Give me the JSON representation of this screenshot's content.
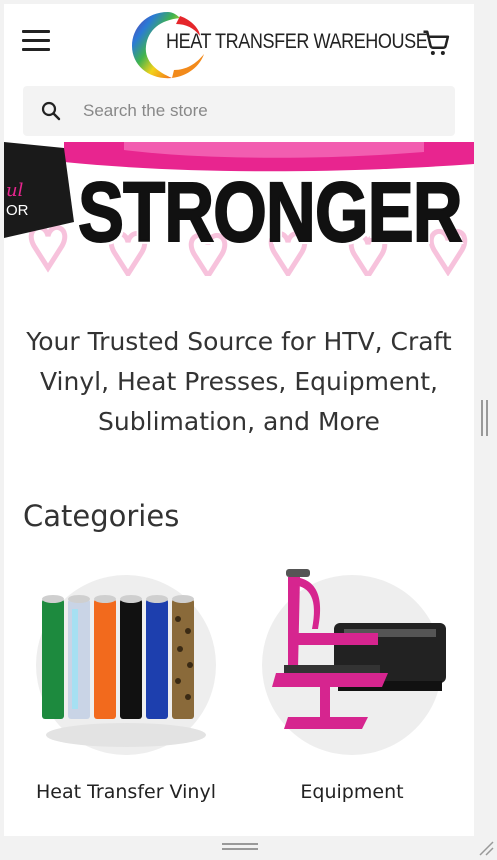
{
  "header": {
    "menu_icon": "hamburger-menu-icon",
    "logo_text": "HEAT TRANSFER WAREHOUSE",
    "cart_icon": "shopping-cart-icon"
  },
  "search": {
    "placeholder": "Search the store",
    "icon": "search-icon"
  },
  "banner": {
    "headline": "STRONGER",
    "side_text_1": "ul",
    "side_text_2": "OR",
    "accent_color": "#e8258f"
  },
  "tagline": "Your Trusted Source for HTV, Craft Vinyl, Heat Presses, Equipment, Sublimation, and More",
  "categories": {
    "heading": "Categories",
    "items": [
      {
        "label": "Heat Transfer Vinyl"
      },
      {
        "label": "Equipment"
      }
    ]
  }
}
